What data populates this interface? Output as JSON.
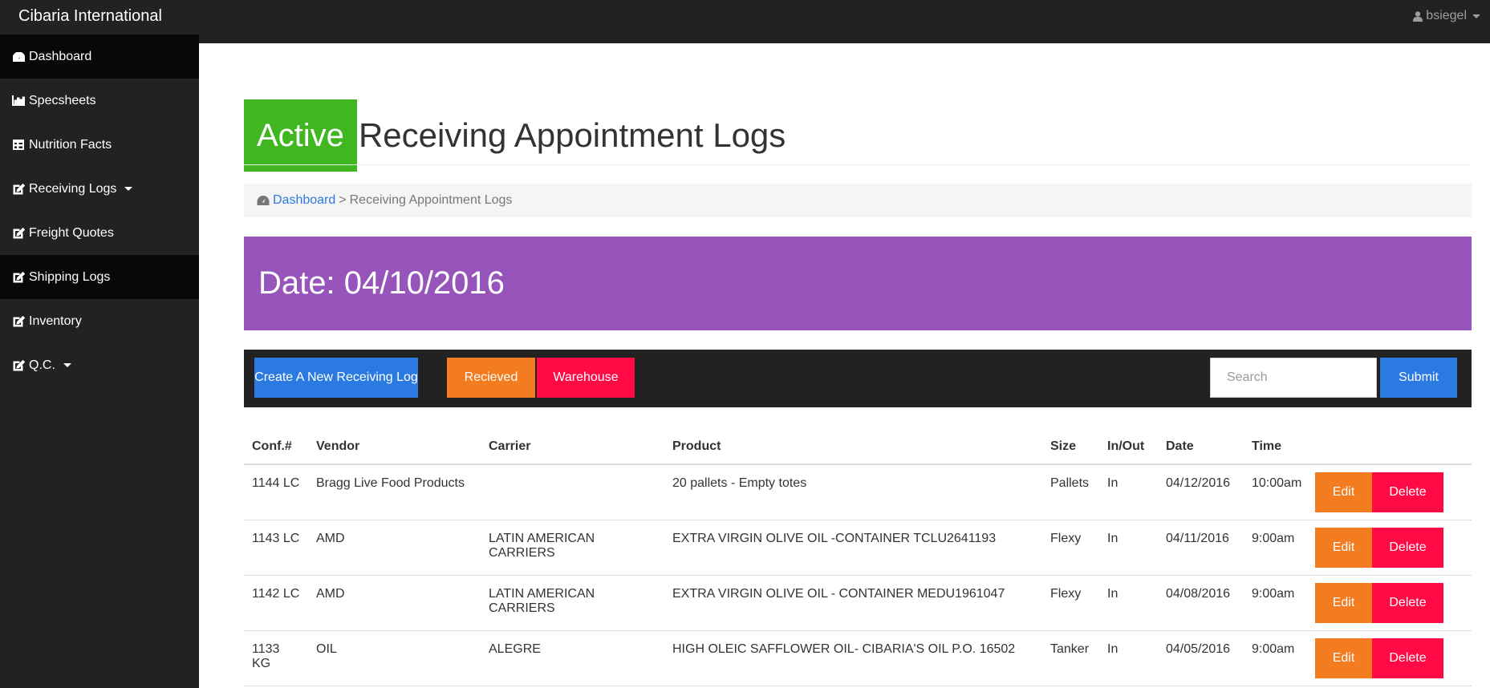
{
  "app": {
    "brand": "Cibaria International",
    "user": "bsiegel"
  },
  "sidebar": {
    "items": [
      {
        "label": "Dashboard",
        "icon": "dashboard-icon"
      },
      {
        "label": "Specsheets",
        "icon": "bar-chart-icon"
      },
      {
        "label": "Nutrition Facts",
        "icon": "table-icon"
      },
      {
        "label": "Receiving Logs",
        "icon": "edit-icon"
      },
      {
        "label": "Freight Quotes",
        "icon": "edit-icon"
      },
      {
        "label": "Shipping Logs",
        "icon": "edit-icon"
      },
      {
        "label": "Inventory",
        "icon": "edit-icon"
      },
      {
        "label": "Q.C.",
        "icon": "edit-icon"
      }
    ]
  },
  "page": {
    "badge": "Active",
    "title": "Receiving Appointment Logs",
    "breadcrumb": {
      "home": "Dashboard",
      "separator": ">",
      "current": "Receiving Appointment Logs"
    },
    "date_banner": "Date: 04/10/2016"
  },
  "toolbar": {
    "create_label": "Create A New Receiving Log",
    "received_label": "Recieved",
    "warehouse_label": "Warehouse",
    "search_placeholder": "Search",
    "submit_label": "Submit"
  },
  "colors": {
    "active_badge": "#40b720",
    "date_banner": "#9755bc",
    "primary": "#2a7ae2",
    "orange": "#f47c20",
    "red": "#ff0a45"
  },
  "table": {
    "headers": {
      "conf": "Conf.#",
      "vendor": "Vendor",
      "carrier": "Carrier",
      "product": "Product",
      "size": "Size",
      "inout": "In/Out",
      "date": "Date",
      "time": "Time"
    },
    "edit_label": "Edit",
    "delete_label": "Delete",
    "rows": [
      {
        "conf": "1144 LC",
        "vendor": "Bragg Live Food Products",
        "carrier": "",
        "product": "20 pallets - Empty totes",
        "size": "Pallets",
        "inout": "In",
        "date": "04/12/2016",
        "time": "10:00am"
      },
      {
        "conf": "1143 LC",
        "vendor": "AMD",
        "carrier": "LATIN AMERICAN CARRIERS",
        "product": "EXTRA VIRGIN OLIVE OIL -CONTAINER TCLU2641193",
        "size": "Flexy",
        "inout": "In",
        "date": "04/11/2016",
        "time": "9:00am"
      },
      {
        "conf": "1142 LC",
        "vendor": "AMD",
        "carrier": "LATIN AMERICAN CARRIERS",
        "product": "EXTRA VIRGIN OLIVE OIL - CONTAINER MEDU1961047",
        "size": "Flexy",
        "inout": "In",
        "date": "04/08/2016",
        "time": "9:00am"
      },
      {
        "conf": "1133 KG",
        "vendor": "OIL",
        "carrier": "ALEGRE",
        "product": "HIGH OLEIC SAFFLOWER OIL- CIBARIA'S OIL P.O. 16502",
        "size": "Tanker",
        "inout": "In",
        "date": "04/05/2016",
        "time": "9:00am"
      }
    ]
  }
}
